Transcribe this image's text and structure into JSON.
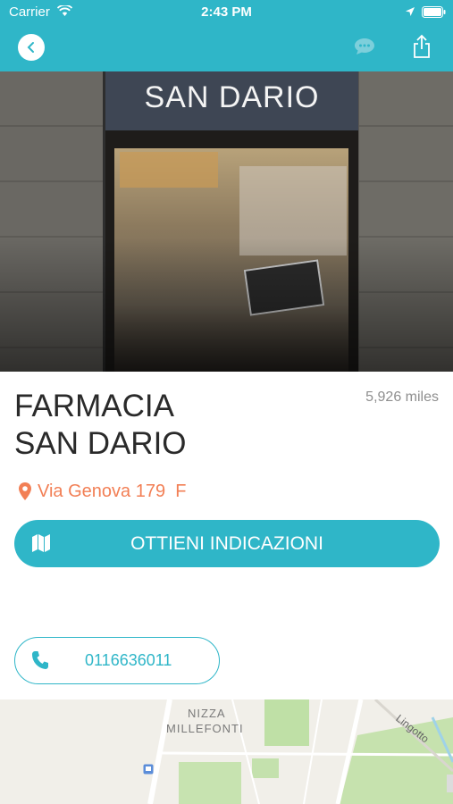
{
  "status_bar": {
    "carrier": "Carrier",
    "time": "2:43 PM"
  },
  "colors": {
    "accent": "#2fb6c8",
    "address": "#f27f55",
    "background": "#ffffff"
  },
  "hero": {
    "sign_text": "SAN DARIO"
  },
  "pharmacy": {
    "name_line1": "FARMACIA",
    "name_line2": "SAN DARIO",
    "distance": "5,926 miles",
    "address": "Via Genova 179  F"
  },
  "actions": {
    "directions_label": "OTTIENI INDICAZIONI",
    "phone_number": "0116636011"
  },
  "map": {
    "label_1": "NIZZA",
    "label_2": "MILLEFONTI",
    "label_3": "Lingotto"
  },
  "icons": [
    "back-icon",
    "chat-icon",
    "share-icon",
    "pin-icon",
    "map-icon",
    "phone-icon",
    "wifi-icon",
    "location-arrow-icon",
    "battery-icon",
    "transit-icon"
  ]
}
